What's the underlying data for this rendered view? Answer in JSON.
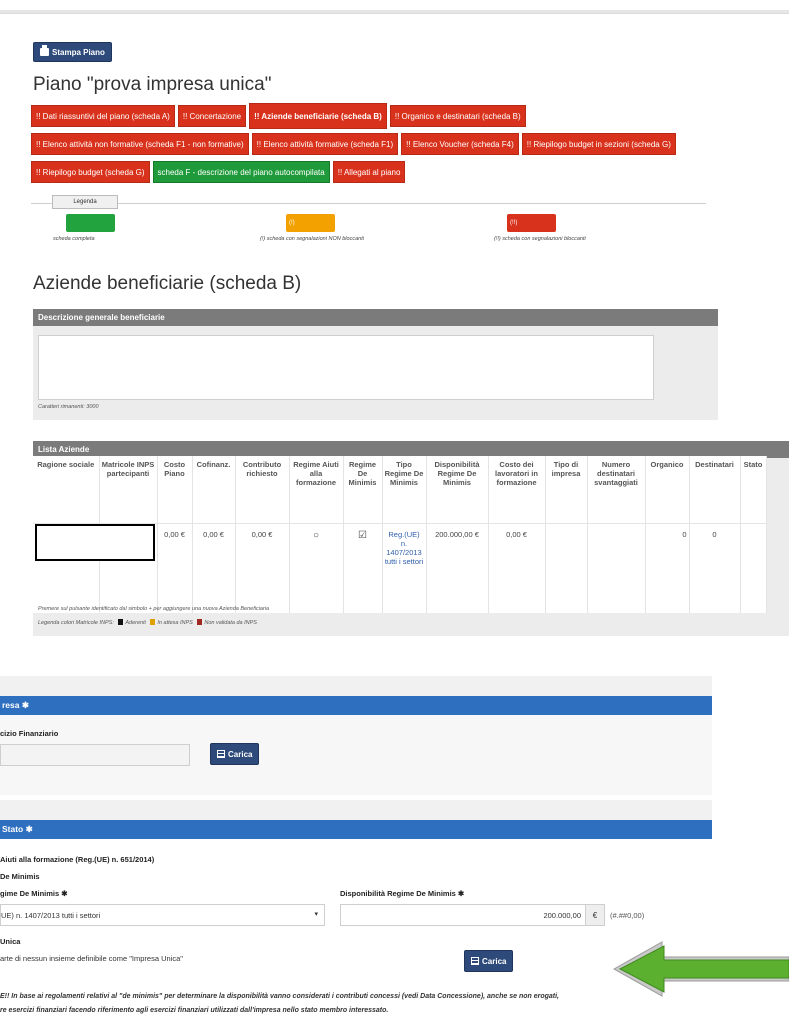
{
  "header": {
    "print_button": "Stampa Piano",
    "plan_title": "Piano \"prova impresa unica\""
  },
  "tabs": [
    {
      "label": "!! Dati riassuntivi del piano (scheda A)",
      "color": "red"
    },
    {
      "label": "!! Concertazione",
      "color": "red"
    },
    {
      "label": "!! Aziende beneficiarie (scheda B)",
      "color": "red",
      "active": true
    },
    {
      "label": "!! Organico e destinatari (scheda B)",
      "color": "red"
    },
    {
      "label": "!! Elenco attività non formative (scheda F1 - non formative)",
      "color": "red"
    },
    {
      "label": "!! Elenco attività formative (scheda F1)",
      "color": "red"
    },
    {
      "label": "!! Elenco Voucher (scheda F4)",
      "color": "red"
    },
    {
      "label": "!! Riepilogo budget in sezioni (scheda G)",
      "color": "red"
    },
    {
      "label": "!! Riepilogo budget (scheda G)",
      "color": "red"
    },
    {
      "label": "scheda F - descrizione del piano autocompilata",
      "color": "green"
    },
    {
      "label": "!! Allegati al piano",
      "color": "red"
    }
  ],
  "legend": {
    "button": "Legenda",
    "items": [
      {
        "swatch": "",
        "label": "scheda completa",
        "color": "#22a33d"
      },
      {
        "swatch": "(!)",
        "label": "(!) scheda con segnalazioni NON bloccanti",
        "color": "#f2a100"
      },
      {
        "swatch": "(!!)",
        "label": "(!!) scheda con segnalazioni bloccanti",
        "color": "#d9321c"
      }
    ]
  },
  "section": {
    "title": "Aziende beneficiarie (scheda B)",
    "desc_panel_title": "Descrizione generale beneficiarie",
    "chars_left": "Caratteri rimanenti: 3000",
    "list_panel_title": "Lista Aziende"
  },
  "table": {
    "headers": [
      "Ragione sociale",
      "Matricole INPS partecipanti",
      "Costo Piano",
      "Cofinanz.",
      "Contributo richiesto",
      "Regime Aiuti alla formazione",
      "Regime De Minimis",
      "Tipo Regime De Minimis",
      "Disponibilità Regime De Minimis",
      "Costo dei lavoratori in formazione",
      "Tipo di impresa",
      "Numero destinatari svantaggiati",
      "Organico",
      "Destinatari",
      "Stato"
    ],
    "row": {
      "ragione": "",
      "matricole": "",
      "costo": "0,00 €",
      "cofinanz": "0,00 €",
      "contributo": "0,00 €",
      "regime_aiuti": "○",
      "regime_de": "☑",
      "tipo_regime": "Reg.(UE) n. 1407/2013 tutti i settori",
      "disponibilita": "200.000,00 €",
      "costo_lavoratori": "0,00 €",
      "tipo_impresa": "",
      "numero": "",
      "organico": "0",
      "destinatari": "0",
      "stato": ""
    },
    "note1": "Premere sul pulsante identificato dal simbolo + per aggiungere una nuova Azienda Beneficiaria",
    "note2_prefix": "Legenda colori Matricole INPS:",
    "note2_items": [
      {
        "label": "Aderenti",
        "color": "#111111"
      },
      {
        "label": "In attesa INPS",
        "color": "#e0a000"
      },
      {
        "label": "Non validata da INPS",
        "color": "#a0281e"
      }
    ]
  },
  "lower": {
    "bar1": "resa ✱",
    "esercizio_label": "cizio Finanziario",
    "carica1": "Carica",
    "bar2": "Stato ✱",
    "aiuti_label": "Aiuti alla formazione (Reg.(UE) n. 651/2014)",
    "de_minimis_label": "De Minimis",
    "regime_label": "gime De Minimis ✱",
    "regime_value": "UE) n. 1407/2013 tutti i settori",
    "disp_label": "Disponibilità Regime De Minimis ✱",
    "disp_value": "200.000,00",
    "euro": "€",
    "format_hint": "(#.##0,00)",
    "unica_label": "Unica",
    "unica_text": "arte di nessun insieme definibile come \"Impresa Unica\"",
    "carica2": "Carica",
    "note_line1": "E!! In base ai regolamenti relativi al \"de minimis\" per determinare la disponibilità vanno considerati i contributi concessi (vedi Data Concessione), anche se non erogati,",
    "note_line2": "re esercizi finanziari facendo riferimento agli esercizi finanziari utilizzati dall'impresa nello stato membro interessato."
  },
  "colors": {
    "red_tab": "#d9321c",
    "green_tab": "#1e9a3a",
    "blue_bar": "#2e6fc0",
    "navy_button": "#2e4a7a",
    "arrow_green": "#5bb030"
  }
}
